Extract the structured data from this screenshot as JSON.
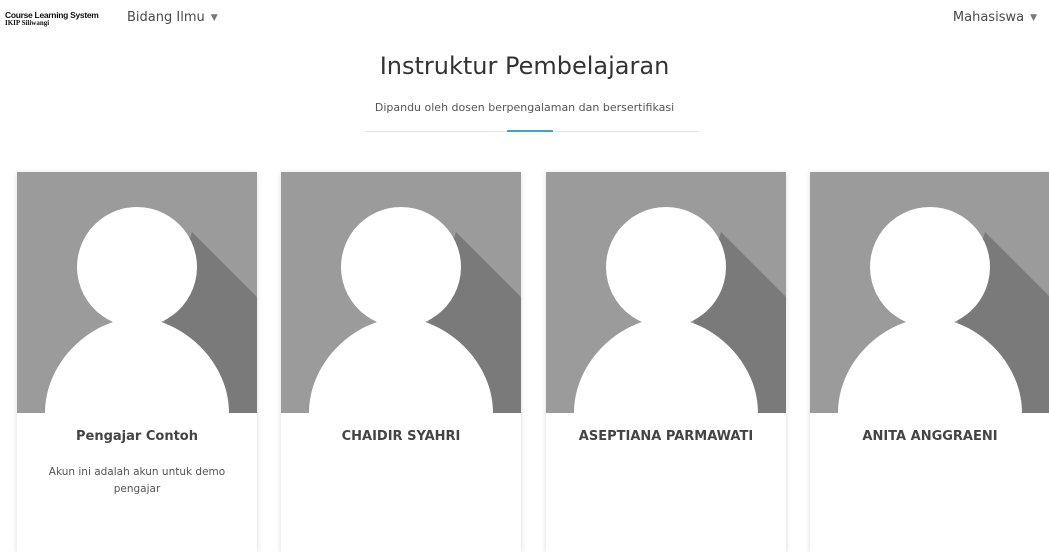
{
  "navbar": {
    "logo_line1": "Course Learning System",
    "logo_line2": "IKIP Siliwangi",
    "bidang_label": "Bidang Ilmu",
    "mahasiswa_label": "Mahasiswa",
    "caret": "▼"
  },
  "section": {
    "title": "Instruktur Pembelajaran",
    "subtitle": "Dipandu oleh dosen berpengalaman dan bersertifikasi",
    "accent_color": "#3aa6c9"
  },
  "instructors": [
    {
      "name": "Pengajar Contoh",
      "description": "Akun ini adalah akun untuk demo pengajar",
      "avatar": "default-user-avatar"
    },
    {
      "name": "CHAIDIR SYAHRI",
      "description": "",
      "avatar": "default-user-avatar"
    },
    {
      "name": "ASEPTIANA PARMAWATI",
      "description": "",
      "avatar": "default-user-avatar"
    },
    {
      "name": "ANITA ANGGRAENI",
      "description": "",
      "avatar": "default-user-avatar"
    }
  ],
  "colors": {
    "avatar_bg": "#9b9b9b",
    "avatar_shadow": "#7a7a7a",
    "avatar_figure": "#ffffff"
  }
}
